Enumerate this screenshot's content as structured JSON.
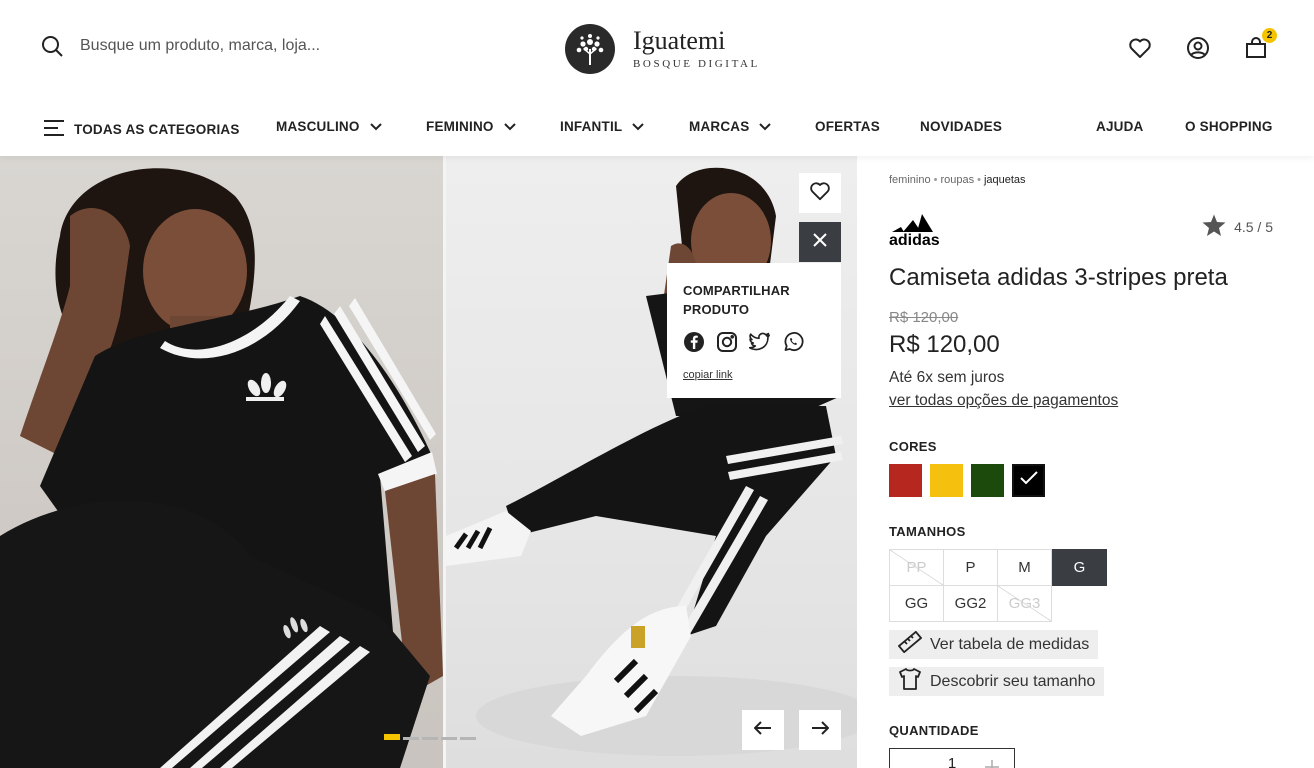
{
  "header": {
    "search_placeholder": "Busque um produto, marca, loja...",
    "logo_name": "Iguatemi",
    "logo_sub": "BOSQUE DIGITAL",
    "cart_count": "2"
  },
  "nav": {
    "all_categories": "TODAS AS CATEGORIAS",
    "items": [
      "MASCULINO",
      "FEMININO",
      "INFANTIL",
      "MARCAS",
      "OFERTAS",
      "NOVIDADES",
      "AJUDA",
      "O SHOPPING"
    ]
  },
  "gallery": {
    "share_title_line1": "COMPARTILHAR",
    "share_title_line2": "PRODUTO",
    "copy_link": "copiar link",
    "slides_total": 5,
    "active_slide": 1
  },
  "product": {
    "breadcrumb": [
      "feminino",
      "roupas",
      "jaquetas"
    ],
    "brand": "adidas",
    "rating": "4.5 / 5",
    "title": "Camiseta adidas 3-stripes preta",
    "old_price": "R$ 120,00",
    "price": "R$ 120,00",
    "installments": "Até 6x sem juros",
    "payment_link": "ver todas opções de pagamentos",
    "colors_label": "CORES",
    "colors": [
      "#b5271f",
      "#f5c10e",
      "#1c4a0c",
      "#000000"
    ],
    "selected_color": 3,
    "sizes_label": "TAMANHOS",
    "sizes": [
      {
        "label": "PP",
        "state": "unavailable"
      },
      {
        "label": "P",
        "state": "available"
      },
      {
        "label": "M",
        "state": "available"
      },
      {
        "label": "G",
        "state": "selected"
      },
      {
        "label": "GG",
        "state": "available"
      },
      {
        "label": "GG2",
        "state": "available"
      },
      {
        "label": "GG3",
        "state": "unavailable"
      }
    ],
    "size_table_link": "Ver tabela de medidas",
    "find_size_link": "Descobrir seu tamanho",
    "quantity_label": "QUANTIDADE",
    "quantity": "1"
  }
}
